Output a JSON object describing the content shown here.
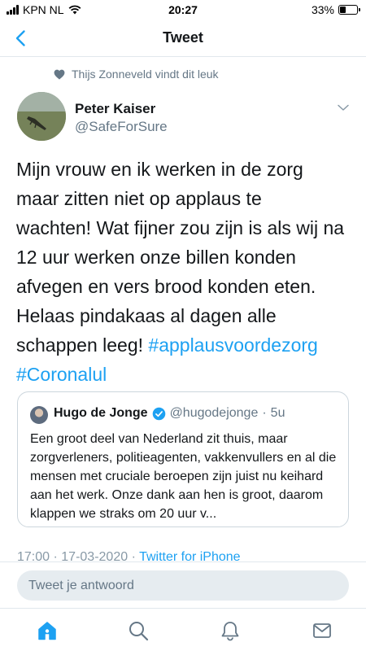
{
  "status_bar": {
    "carrier": "KPN NL",
    "time": "20:27",
    "battery_pct": "33%",
    "battery_level": 0.33
  },
  "nav": {
    "title": "Tweet",
    "back_icon": "chevron-left-icon"
  },
  "social_context": {
    "text": "Thijs Zonneveld vindt dit leuk",
    "icon": "heart-icon"
  },
  "tweet": {
    "author_name": "Peter Kaiser",
    "author_handle": "@SafeForSure",
    "text_lines": [
      "Mijn vrouw en ik werken in de zorg",
      "maar zitten niet op applaus te",
      "wachten! Wat fijner zou zijn is als wij na",
      "12 uur werken onze billen konden",
      "afvegen en vers brood konden eten.",
      "Helaas pindakaas al dagen alle",
      "schappen leeg! "
    ],
    "hashtag_1": "#applausvoordezorg",
    "hashtag_2": "#Coronalul"
  },
  "quoted_tweet": {
    "name": "Hugo de Jonge",
    "handle": "@hugodejonge",
    "separator": "·",
    "age": "5u",
    "text": "Een groot deel van Nederland zit thuis, maar zorgverleners, politieagenten, vakkenvullers en al die mensen met cruciale beroepen zijn juist nu keihard aan het werk. Onze dank aan hen is groot, daarom klappen we straks om 20 uur v..."
  },
  "meta": {
    "time": "17:00",
    "date": "17-03-2020",
    "separator": "·",
    "client": "Twitter for iPhone"
  },
  "reply": {
    "placeholder": "Tweet je antwoord"
  },
  "tab_bar": {
    "items": [
      "home-icon",
      "search-icon",
      "notifications-icon",
      "messages-icon"
    ],
    "active_color": "#1da1f2",
    "inactive_color": "#657786"
  }
}
